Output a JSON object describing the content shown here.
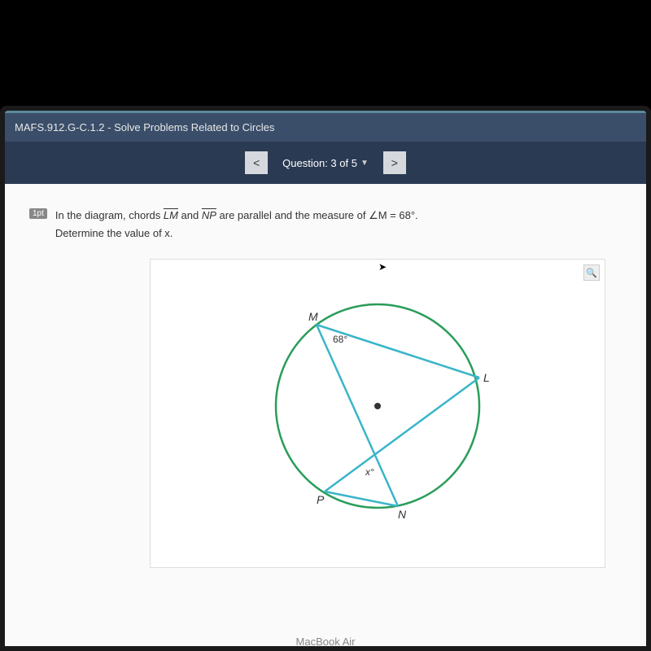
{
  "header": {
    "title": "MAFS.912.G-C.1.2 - Solve Problems Related to Circles"
  },
  "nav": {
    "prev_label": "<",
    "next_label": ">",
    "question_counter": "Question: 3 of 5"
  },
  "question": {
    "points": "1pt",
    "text_part1": "In the diagram, chords ",
    "chord1": "LM",
    "text_part2": " and ",
    "chord2": "NP",
    "text_part3": " are parallel and the measure of ∠M = 68°.",
    "text_line2": "Determine the value of x."
  },
  "diagram": {
    "label_M": "M",
    "label_L": "L",
    "label_P": "P",
    "label_N": "N",
    "angle_M": "68°",
    "angle_x": "x°"
  },
  "device": {
    "label": "MacBook Air"
  },
  "icons": {
    "zoom": "🔍",
    "dropdown": "▼",
    "cursor": "▲"
  }
}
